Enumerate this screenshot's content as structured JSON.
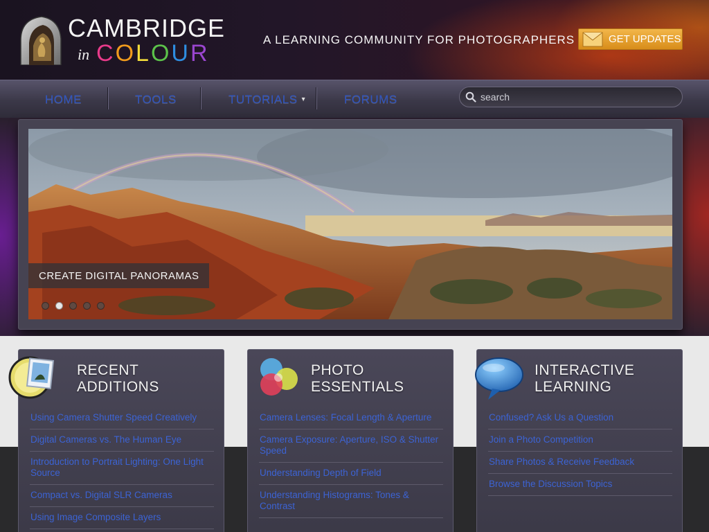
{
  "header": {
    "logo_title": "CAMBRIDGE",
    "logo_in": "in",
    "logo_colour_letters": [
      "C",
      "O",
      "L",
      "O",
      "U",
      "R"
    ],
    "logo_colour_colors": [
      "#e83a8a",
      "#f29b1c",
      "#f4dd3a",
      "#5cc24a",
      "#2e8de0",
      "#9a46d0"
    ],
    "tagline": "A LEARNING COMMUNITY FOR PHOTOGRAPHERS",
    "updates_button": "GET UPDATES",
    "updates_icon": "envelope-icon",
    "accent_color": "#e3a12d"
  },
  "nav": {
    "items": [
      {
        "label": "HOME"
      },
      {
        "label": "TOOLS"
      },
      {
        "label": "TUTORIALS"
      },
      {
        "label": "FORUMS"
      }
    ],
    "tutorials_caret": "▾",
    "link_color": "#2f55c0",
    "search": {
      "placeholder": "search",
      "value": ""
    }
  },
  "hero": {
    "caption": "CREATE DIGITAL PANORAMAS",
    "slide_count": 5,
    "active_slide": 1
  },
  "panels": [
    {
      "title_line1": "RECENT",
      "title_line2": "ADDITIONS",
      "icon": "photo-frame-icon",
      "links": [
        "Using Camera Shutter Speed Creatively",
        "Digital Cameras vs. The Human Eye",
        "Introduction to Portrait Lighting: One Light Source",
        "Compact vs. Digital SLR Cameras",
        "Using Image Composite Layers"
      ]
    },
    {
      "title_line1": "PHOTO",
      "title_line2": "ESSENTIALS",
      "icon": "color-circles-icon",
      "links": [
        "Camera Lenses: Focal Length & Aperture",
        "Camera Exposure: Aperture, ISO & Shutter Speed",
        "Understanding Depth of Field",
        "Understanding Histograms: Tones & Contrast"
      ]
    },
    {
      "title_line1": "INTERACTIVE",
      "title_line2": "LEARNING",
      "icon": "speech-bubble-icon",
      "links": [
        "Confused? Ask Us a Question",
        "Join a Photo Competition",
        "Share Photos & Receive Feedback",
        "Browse the Discussion Topics"
      ]
    }
  ]
}
